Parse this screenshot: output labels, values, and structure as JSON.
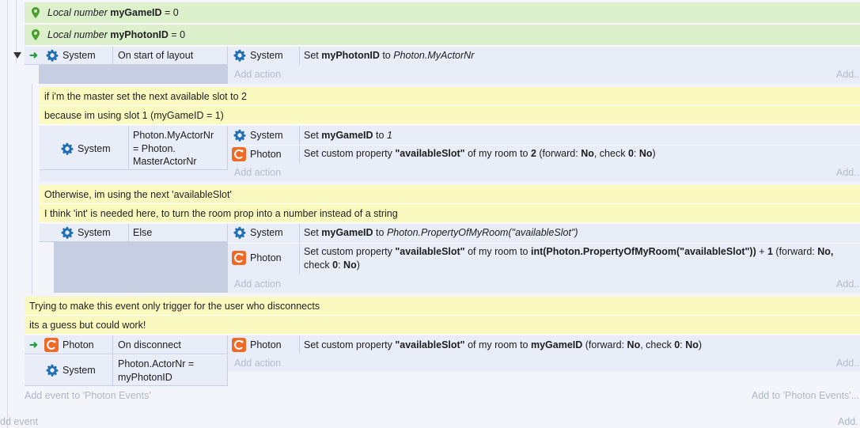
{
  "variables": [
    {
      "label": "Local number",
      "name": "myGameID",
      "value_text": "= 0"
    },
    {
      "label": "Local number",
      "name": "myPhotonID",
      "value_text": "= 0"
    }
  ],
  "event1": {
    "cond_plugin": "System",
    "cond_text": "On start of layout",
    "action_plugin": "System",
    "action_pre": "Set ",
    "action_bold": "myPhotonID",
    "action_mid": " to ",
    "action_italic": "Photon.MyActorNr",
    "add_action": "Add action",
    "add_right": "Add.."
  },
  "sub1": {
    "comments": [
      "if i'm the master set the next available slot to 2",
      "because im using slot 1 (myGameID = 1)"
    ],
    "cond_plugin": "System",
    "cond_lines": [
      "Photon.MyActorNr",
      "= Photon.",
      "MasterActorNr"
    ],
    "action1_plugin": "System",
    "action1_pre": "Set ",
    "action1_bold": "myGameID",
    "action1_mid": " to ",
    "action1_italic": "1",
    "action2_plugin": "Photon",
    "action2_t1": "Set custom property ",
    "action2_b1": "\"availableSlot\"",
    "action2_t2": " of my room to ",
    "action2_b2": "2",
    "action2_t3": " (forward: ",
    "action2_b3": "No",
    "action2_t4": ", check ",
    "action2_b4": "0",
    "action2_t5": ": ",
    "action2_b5": "No",
    "action2_t6": ")",
    "add_action": "Add action",
    "add_right": "Add.."
  },
  "sub2": {
    "comments": [
      "Otherwise, im using the next 'availableSlot'",
      "I think 'int' is needed here, to turn the room prop into a number instead of a string"
    ],
    "cond_plugin": "System",
    "cond_text": "Else",
    "action1_plugin": "System",
    "action1_pre": "Set ",
    "action1_bold": "myGameID",
    "action1_mid": " to ",
    "action1_italic": "Photon.PropertyOfMyRoom(\"availableSlot\")",
    "action2_plugin": "Photon",
    "action2_t1": "Set custom property ",
    "action2_b1": "\"availableSlot\"",
    "action2_t2": " of my room to ",
    "action2_b2": "int(Photon.PropertyOfMyRoom(\"availableSlot\"))",
    "action2_t3": " + ",
    "action2_b3": "1",
    "action2_t4": " (forward: ",
    "action2_b4": "No,",
    "action2_line2_b1": "check ",
    "action2_line2_b2": "0",
    "action2_line2_t1": ": ",
    "action2_line2_b3": "No",
    "action2_line2_t2": ")",
    "add_action": "Add action",
    "add_right": "Add.."
  },
  "event2": {
    "comments": [
      "Trying to make this event only trigger for the user who disconnects",
      "its a guess but could work!"
    ],
    "cond1_plugin": "Photon",
    "cond1_text": "On disconnect",
    "cond2_plugin": "System",
    "cond2_lines": [
      "Photon.ActorNr =",
      "myPhotonID"
    ],
    "action_plugin": "Photon",
    "action_t1": "Set custom property ",
    "action_b1": "\"availableSlot\"",
    "action_t2": " of my room to ",
    "action_b2": "myGameID",
    "action_t3": " (forward: ",
    "action_b3": "No",
    "action_t4": ", check ",
    "action_b4": "0",
    "action_t5": ": ",
    "action_b5": "No",
    "action_t6": ")",
    "add_action": "Add action",
    "add_right": "Add.."
  },
  "footer": {
    "add_event_to": "Add event to 'Photon Events'",
    "add_event_to_right": "Add to 'Photon Events'...",
    "add_event": "dd event",
    "add_right": "Add."
  },
  "colors": {
    "variable_bg": "#dcf0cc",
    "comment_bg": "#fafac0",
    "block_bg": "#e8edf8",
    "gear": "#1f6fb2",
    "photon": "#ee6a26"
  }
}
